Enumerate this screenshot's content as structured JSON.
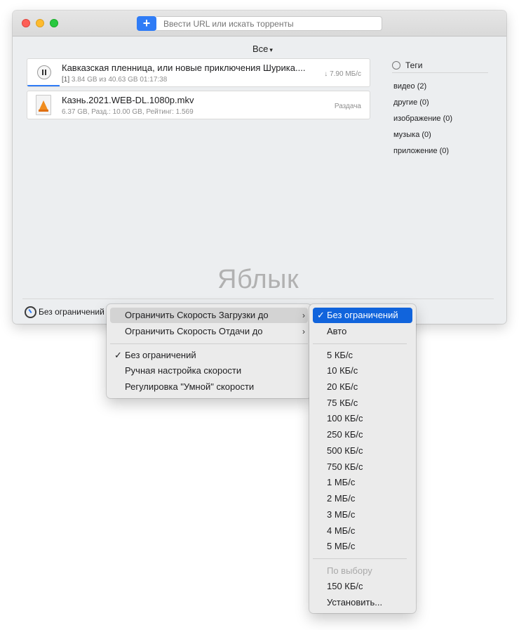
{
  "toolbar": {
    "add_label": "+",
    "search_placeholder": "Ввести URL или искать торренты"
  },
  "filter": {
    "label": "Все"
  },
  "torrents": [
    {
      "name": "Кавказская пленница, или новые приключения Шурика....",
      "index": "[1]",
      "info": "3.84 GB из 40.63 GB 01:17:38",
      "status": "↓ 7.90 МБ/с",
      "progress": 0.095
    },
    {
      "name": "Казнь.2021.WEB-DL.1080p.mkv",
      "info": "6.37 GB, Разд.: 10.00 GB, Рейтинг: 1.569",
      "status": "Раздача"
    }
  ],
  "tags": {
    "title": "Теги",
    "items": [
      {
        "label": "видео (2)"
      },
      {
        "label": "другие (0)"
      },
      {
        "label": "изображение (0)"
      },
      {
        "label": "музыка (0)"
      },
      {
        "label": "приложение (0)"
      }
    ]
  },
  "watermark": "Яблык",
  "statusbar": {
    "speed_label": "Без ограничений"
  },
  "menu": {
    "items": [
      {
        "label": "Ограничить Скорость Загрузки до"
      },
      {
        "label": "Ограничить Скорость Отдачи до"
      },
      {
        "label": "Без ограничений",
        "checked": true
      },
      {
        "label": "Ручная настройка скорости"
      },
      {
        "label": "Регулировка \"Умной\" скорости"
      }
    ],
    "checkmark": "✓",
    "submenu_arrow": "›"
  },
  "submenu": {
    "items": [
      {
        "label": "Без ограничений",
        "checked": true
      },
      {
        "label": "Авто"
      },
      {
        "label": "5 КБ/с"
      },
      {
        "label": "10 КБ/с"
      },
      {
        "label": "20 КБ/с"
      },
      {
        "label": "75 КБ/с"
      },
      {
        "label": "100 КБ/с"
      },
      {
        "label": "250 КБ/с"
      },
      {
        "label": "500 КБ/с"
      },
      {
        "label": "750 КБ/с"
      },
      {
        "label": "1 МБ/с"
      },
      {
        "label": "2 МБ/с"
      },
      {
        "label": "3 МБ/с"
      },
      {
        "label": "4 МБ/с"
      },
      {
        "label": "5 МБ/с"
      },
      {
        "label": "По выбору"
      },
      {
        "label": "150 КБ/с"
      },
      {
        "label": "Установить..."
      }
    ]
  },
  "colors": {
    "accent": "#2f7cf6",
    "menu_highlight": "#1164dc"
  }
}
